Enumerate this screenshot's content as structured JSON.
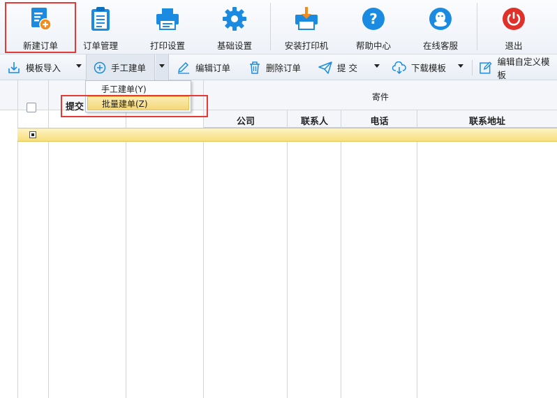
{
  "ribbon": {
    "items": [
      {
        "label": "新建订单",
        "icon": "new-order-icon"
      },
      {
        "label": "订单管理",
        "icon": "clipboard-icon"
      },
      {
        "label": "打印设置",
        "icon": "printer-icon"
      },
      {
        "label": "基础设置",
        "icon": "gear-icon"
      },
      {
        "label": "安装打印机",
        "icon": "install-printer-icon"
      },
      {
        "label": "帮助中心",
        "icon": "help-icon"
      },
      {
        "label": "在线客服",
        "icon": "customer-service-icon"
      },
      {
        "label": "退出",
        "icon": "power-icon"
      }
    ]
  },
  "toolbar": {
    "template_import": "模板导入",
    "manual_create": "手工建单",
    "edit_order": "编辑订单",
    "delete_order": "删除订单",
    "submit": "提 交",
    "download_template": "下载模板",
    "edit_custom": "编辑自定义模板"
  },
  "dropdown": {
    "items": [
      "手工建单(Y)",
      "批量建单(Z)"
    ],
    "selected_index": 1
  },
  "grid": {
    "col_submit": "提交",
    "group_sender": "寄件",
    "columns": [
      "公司",
      "联系人",
      "电话",
      "联系地址"
    ]
  },
  "colors": {
    "accent_blue": "#1a8be0",
    "exit_red": "#e0302a",
    "highlight_red": "#e53935",
    "row_yellow": "#f7de7c"
  }
}
